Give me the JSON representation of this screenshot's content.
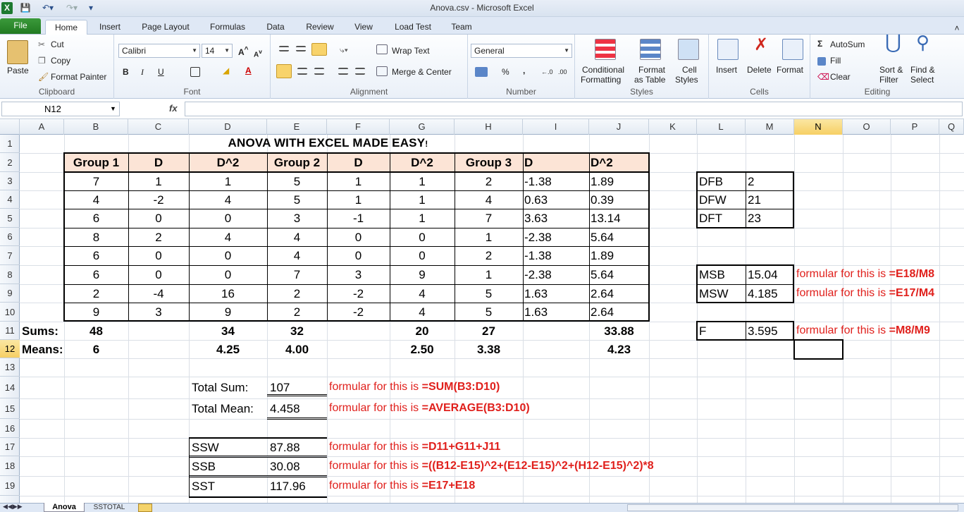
{
  "window": {
    "title": "Anova.csv  -  Microsoft Excel"
  },
  "tabs": [
    "File",
    "Home",
    "Insert",
    "Page Layout",
    "Formulas",
    "Data",
    "Review",
    "View",
    "Load Test",
    "Team"
  ],
  "ribbon": {
    "clipboard": {
      "paste": "Paste",
      "cut": "Cut",
      "copy": "Copy",
      "format_painter": "Format Painter",
      "label": "Clipboard"
    },
    "font": {
      "name": "Calibri",
      "size": "14",
      "label": "Font",
      "bold": "B",
      "italic": "I",
      "underline": "U"
    },
    "alignment": {
      "wrap": "Wrap Text",
      "merge": "Merge & Center",
      "label": "Alignment"
    },
    "number": {
      "format": "General",
      "percent": "%",
      "comma": ",",
      "label": "Number"
    },
    "styles": {
      "conditional": "Conditional",
      "conditional2": "Formatting",
      "format_table": "Format",
      "format_table2": "as Table",
      "cell_styles": "Cell",
      "cell_styles2": "Styles",
      "label": "Styles"
    },
    "cells": {
      "insert": "Insert",
      "delete": "Delete",
      "format": "Format",
      "label": "Cells"
    },
    "editing": {
      "autosum": "AutoSum",
      "fill": "Fill",
      "clear": "Clear",
      "sort": "Sort &",
      "sort2": "Filter",
      "find": "Find &",
      "find2": "Select",
      "label": "Editing"
    }
  },
  "formula_bar": {
    "name_box": "N12",
    "fx": "fx",
    "value": ""
  },
  "columns": [
    "A",
    "B",
    "C",
    "D",
    "E",
    "F",
    "G",
    "H",
    "I",
    "J",
    "K",
    "L",
    "M",
    "N",
    "O",
    "P",
    "Q"
  ],
  "rows": [
    "1",
    "2",
    "3",
    "4",
    "5",
    "6",
    "7",
    "8",
    "9",
    "10",
    "11",
    "12",
    "13",
    "14",
    "15",
    "16",
    "17",
    "18",
    "19"
  ],
  "sheet": {
    "title": "ANOVA WITH EXCEL MADE EASY",
    "title_mark": "!",
    "headers": [
      "Group 1",
      "D",
      "D^2",
      "Group 2",
      "D",
      "D^2",
      "Group 3",
      "D",
      "D^2"
    ],
    "data": [
      [
        "7",
        "1",
        "1",
        "5",
        "1",
        "1",
        "2",
        "-1.38",
        "1.89"
      ],
      [
        "4",
        "-2",
        "4",
        "5",
        "1",
        "1",
        "4",
        "0.63",
        "0.39"
      ],
      [
        "6",
        "0",
        "0",
        "3",
        "-1",
        "1",
        "7",
        "3.63",
        "13.14"
      ],
      [
        "8",
        "2",
        "4",
        "4",
        "0",
        "0",
        "1",
        "-2.38",
        "5.64"
      ],
      [
        "6",
        "0",
        "0",
        "4",
        "0",
        "0",
        "2",
        "-1.38",
        "1.89"
      ],
      [
        "6",
        "0",
        "0",
        "7",
        "3",
        "9",
        "1",
        "-2.38",
        "5.64"
      ],
      [
        "2",
        "-4",
        "16",
        "2",
        "-2",
        "4",
        "5",
        "1.63",
        "2.64"
      ],
      [
        "9",
        "3",
        "9",
        "2",
        "-2",
        "4",
        "5",
        "1.63",
        "2.64"
      ]
    ],
    "sums_label": "Sums:",
    "sums": [
      "48",
      "",
      "34",
      "32",
      "",
      "20",
      "27",
      "",
      "33.88"
    ],
    "means_label": "Means:",
    "means": [
      "6",
      "",
      "4.25",
      "4.00",
      "",
      "2.50",
      "3.38",
      "",
      "4.23"
    ],
    "df": [
      {
        "label": "DFB",
        "value": "2"
      },
      {
        "label": "DFW",
        "value": "21"
      },
      {
        "label": "DFT",
        "value": "23"
      }
    ],
    "ms": [
      {
        "label": "MSB",
        "value": "15.04",
        "note": "formular for this is ",
        "formula": "=E18/M8"
      },
      {
        "label": "MSW",
        "value": "4.185",
        "note": "formular for this is ",
        "formula": "=E17/M4"
      }
    ],
    "f": {
      "label": "F",
      "value": "3.595",
      "note": "formular for this is ",
      "formula": "=M8/M9"
    },
    "totals": [
      {
        "label": "Total Sum:",
        "value": "107",
        "note": "formular for this is ",
        "formula": "=SUM(B3:D10)"
      },
      {
        "label": "Total Mean:",
        "value": "4.458",
        "note": "formular for this is ",
        "formula": "=AVERAGE(B3:D10)"
      }
    ],
    "ss": [
      {
        "label": "SSW",
        "value": "87.88",
        "note": "formular for this is ",
        "formula": "=D11+G11+J11"
      },
      {
        "label": "SSB",
        "value": "30.08",
        "note": "formular for this is ",
        "formula": "=((B12-E15)^2+(E12-E15)^2+(H12-E15)^2)*8"
      },
      {
        "label": "SST",
        "value": "117.96",
        "note": "formular for this is ",
        "formula": "=E17+E18"
      }
    ]
  },
  "sheet_tabs": [
    "Anova",
    "SSTOTAL"
  ]
}
